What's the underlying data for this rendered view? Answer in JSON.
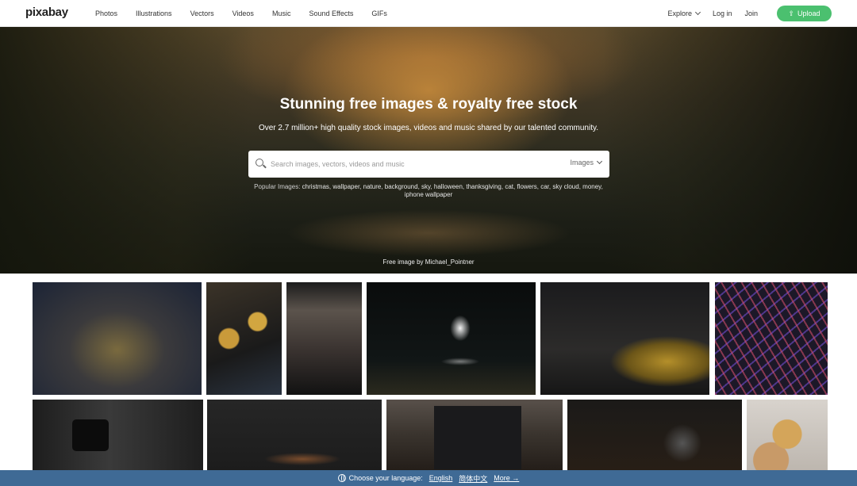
{
  "nav": {
    "logo": "pixabay",
    "links": [
      "Photos",
      "Illustrations",
      "Vectors",
      "Videos",
      "Music",
      "Sound Effects",
      "GIFs"
    ],
    "explore": "Explore",
    "login": "Log in",
    "join": "Join",
    "upload": "Upload"
  },
  "hero": {
    "title": "Stunning free images & royalty free stock",
    "subtitle": "Over 2.7 million+ high quality stock images, videos and music shared by our talented community.",
    "search_placeholder": "Search images, vectors, videos and music",
    "search_type": "Images",
    "popular_lead": "Popular Images:",
    "popular_tags": [
      "christmas",
      "wallpaper",
      "nature",
      "background",
      "sky",
      "halloween",
      "thanksgiving",
      "cat",
      "flowers",
      "car",
      "sky cloud",
      "money",
      "iphone wallpaper"
    ],
    "credit": "Free image by Michael_Pointner"
  },
  "language_bar": {
    "label": "Choose your language:",
    "english": "English",
    "chinese": "简体中文",
    "more": "More →"
  },
  "colors": {
    "accent_green": "#4bc06f",
    "language_bar": "#3f6a95"
  }
}
